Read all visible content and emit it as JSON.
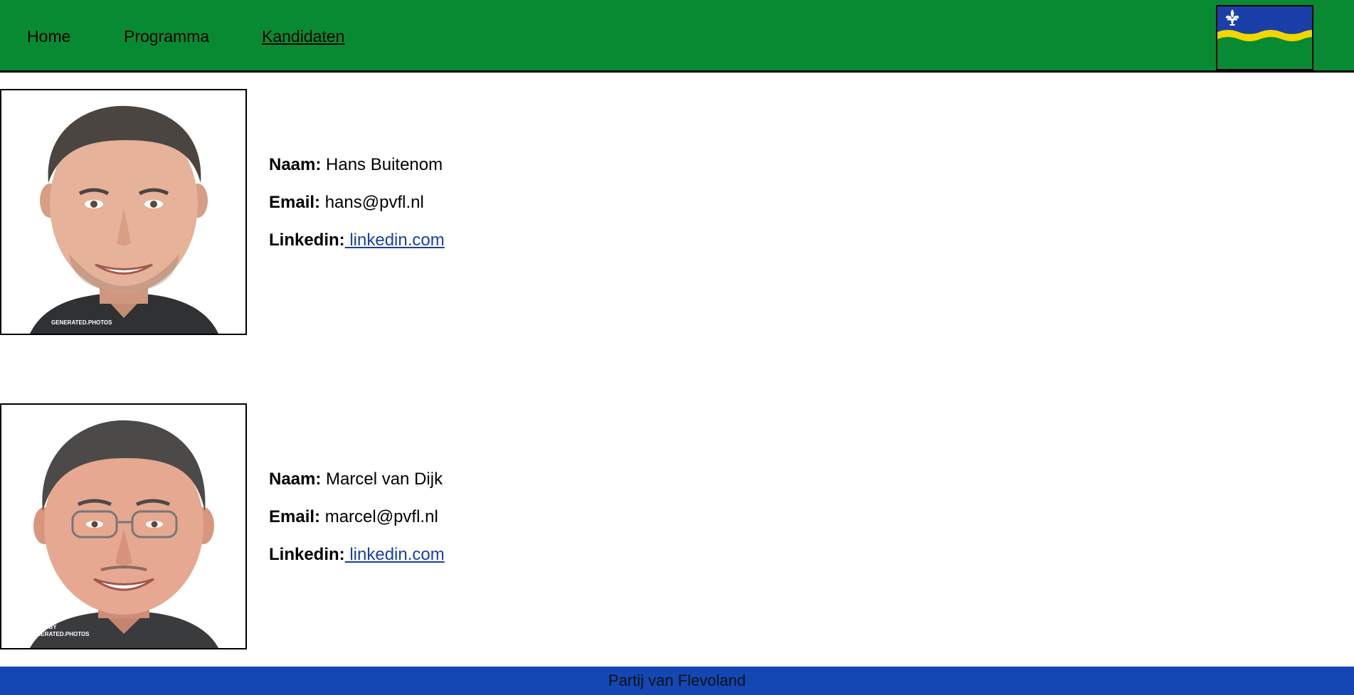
{
  "nav": {
    "items": [
      "Home",
      "Programma",
      "Kandidaten"
    ],
    "active": "Kandidaten"
  },
  "labels": {
    "name": "Naam:",
    "email": "Email:",
    "linkedin": "Linkedin:"
  },
  "candidates": [
    {
      "name": "Hans Buitenom",
      "email": "hans@pvfl.nl",
      "linkedin": " linkedin.com",
      "photo_watermark": "GENERATED.PHOTOS"
    },
    {
      "name": "Marcel van Dijk",
      "email": "marcel@pvfl.nl",
      "linkedin": " linkedin.com",
      "photo_watermark": "IMAGE BY GENERATED.PHOTOS"
    }
  ],
  "footer": {
    "text": "Partij van Flevoland"
  },
  "colors": {
    "nav_bg": "#088a33",
    "footer_bg": "#1447b3",
    "flag_blue": "#1a3fa8",
    "flag_yellow": "#f2d600",
    "flag_green": "#088a33",
    "link": "#1a3fa8"
  }
}
